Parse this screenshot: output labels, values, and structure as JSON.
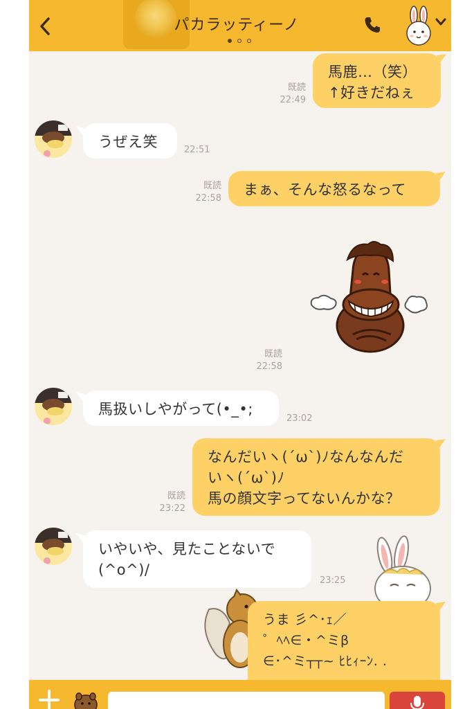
{
  "header": {
    "title": "パカラッティーノ",
    "page_dots": 3,
    "active_dot": 0,
    "accent_color": "#f5b82e"
  },
  "messages": [
    {
      "id": "m1",
      "side": "out",
      "text": "馬鹿…（笑）\n↑好きだねぇ",
      "read": "既読",
      "time": "22:49"
    },
    {
      "id": "m2",
      "side": "in",
      "text": "うぜえ笑",
      "time": "22:51"
    },
    {
      "id": "m3",
      "side": "out",
      "text": "まぁ、そんな怒るなって",
      "read": "既読",
      "time": "22:58"
    },
    {
      "id": "m4",
      "side": "out",
      "sticker": "grinning-horse-sticker",
      "read": "既読",
      "time": "22:58"
    },
    {
      "id": "m5",
      "side": "in",
      "text": "馬扱いしやがって(•_•;",
      "time": "23:02"
    },
    {
      "id": "m6",
      "side": "out",
      "text": "なんだいヽ(´ω`)ﾉなんなんだ\nいヽ(´ω`)ﾉ\n馬の顔文字ってないんかな？",
      "read": "既読",
      "time": "23:22"
    },
    {
      "id": "m7",
      "side": "in",
      "text": "いやいや、見たことないで\n(^o^)/",
      "time": "23:25"
    },
    {
      "id": "m8",
      "side": "out",
      "text": "うま 彡^･ｪ／\n゜ﾍﾍ∈・^ミβ\n∈･^ミ┬┬~ ﾋﾋｨｰﾝ.  .",
      "read": "",
      "time": ""
    }
  ],
  "colors": {
    "outgoing_bubble": "#fdd165",
    "incoming_bubble": "#ffffff",
    "background": "#f6f3ee",
    "mic_button": "#d9453d"
  },
  "icons": {
    "back": "chevron-left-icon",
    "call": "phone-icon",
    "menu": "chevron-down-icon",
    "add": "plus-icon",
    "sticker": "sticker-icon",
    "mic": "mic-icon"
  },
  "composer": {
    "placeholder": ""
  }
}
